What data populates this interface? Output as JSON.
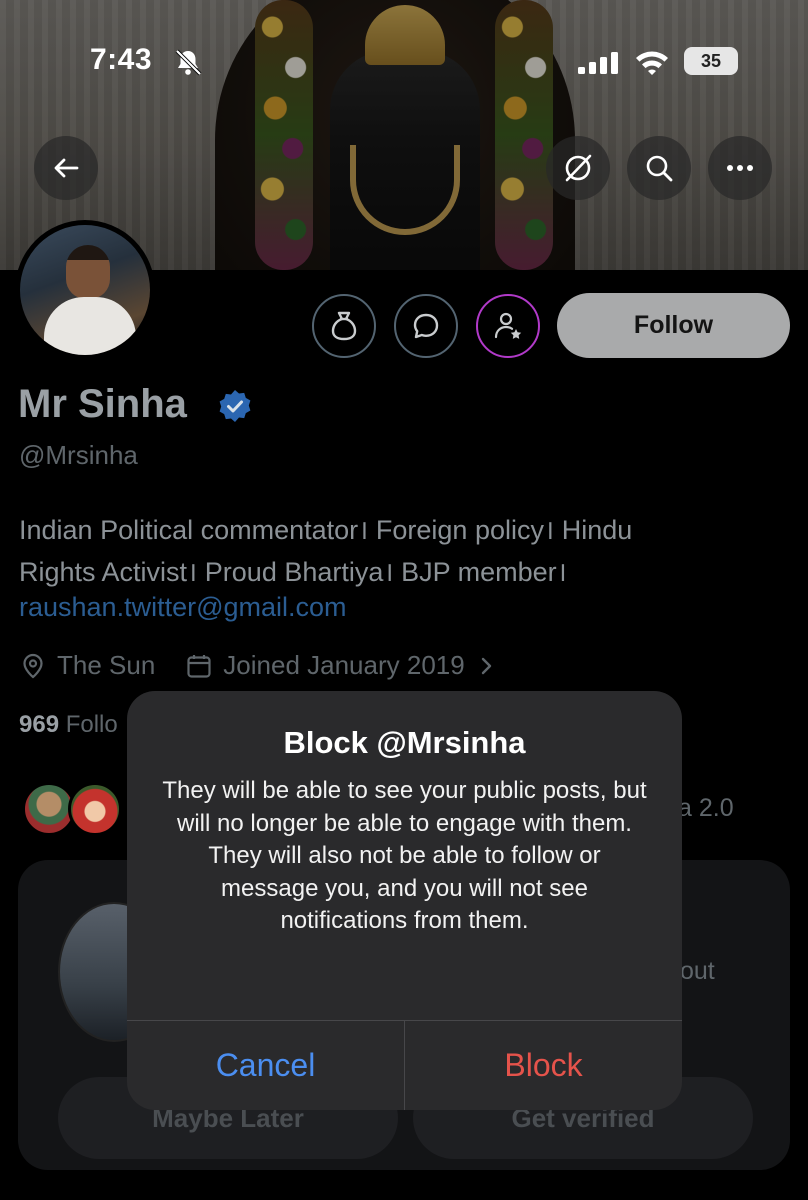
{
  "status_bar": {
    "time": "7:43",
    "battery": "35",
    "icons": [
      "bell-muted-icon",
      "cellular-signal-icon",
      "wifi-icon",
      "battery-icon"
    ]
  },
  "nav": {
    "icons": [
      "back-arrow-icon",
      "grok-icon",
      "search-icon",
      "more-icon"
    ]
  },
  "profile": {
    "follow_label": "Follow",
    "name": "Mr Sinha",
    "handle": "@Mrsinha",
    "bio_line1": "Indian Political commentator। Foreign policy। Hindu",
    "bio_line2": "Rights Activist। Proud Bhartiya। BJP member।",
    "bio_link": "raushan.twitter@gmail.com",
    "location": "The Sun",
    "joined": "Joined January 2019",
    "followers_count": "969",
    "followers_label_partial": "Follo",
    "followed_by_partial": "a 2.0",
    "action_icons": [
      "tip-jar-icon",
      "message-bubble-icon",
      "subscribe-person-star-icon"
    ],
    "verified_color": "#2b66b1"
  },
  "premium_card": {
    "text_partial": "out",
    "maybe_later": "Maybe Later",
    "get_verified": "Get verified"
  },
  "alert": {
    "title": "Block @Mrsinha",
    "message": "They will be able to see your public posts, but will no longer be able to engage with them. They will also not be able to follow or message you, and you will not see notifications from them.",
    "cancel_label": "Cancel",
    "block_label": "Block",
    "cancel_color": "#4b8ef0",
    "block_color": "#e5534b"
  }
}
